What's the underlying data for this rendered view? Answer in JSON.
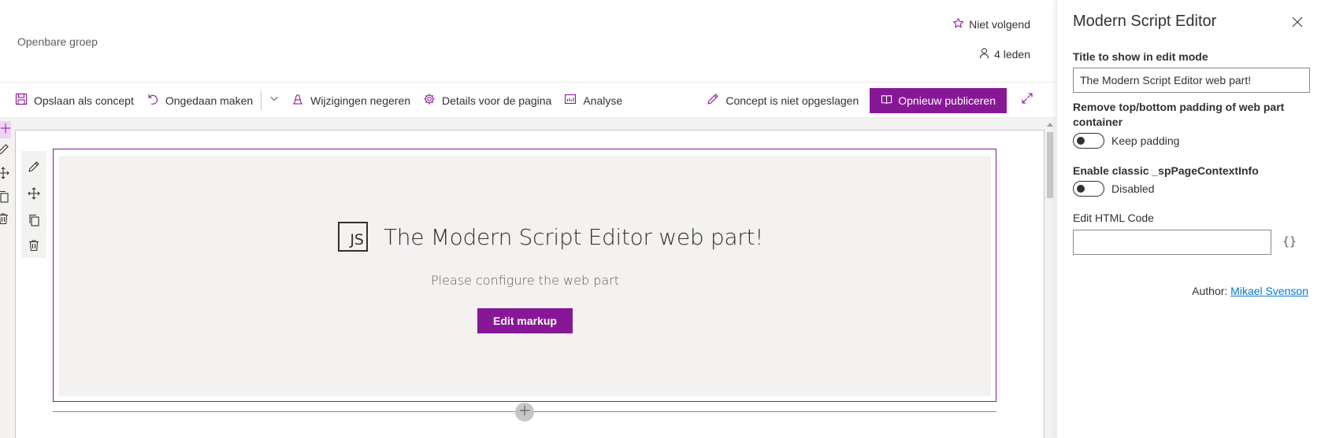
{
  "header": {
    "group_type": "Openbare groep",
    "follow_label": "Niet volgend",
    "members_label": "4 leden"
  },
  "toolbar": {
    "save_draft": "Opslaan als concept",
    "undo": "Ongedaan maken",
    "discard": "Wijzigingen negeren",
    "page_details": "Details voor de pagina",
    "analytics": "Analyse",
    "draft_status": "Concept is niet opgeslagen",
    "republish": "Opnieuw publiceren"
  },
  "webpart": {
    "logo_text": "JS",
    "title": "The Modern Script Editor web part!",
    "subtitle": "Please configure the web part",
    "edit_button": "Edit markup"
  },
  "pane": {
    "title": "Modern Script Editor",
    "title_field_label": "Title to show in edit mode",
    "title_field_value": "The Modern Script Editor web part!",
    "padding_label": "Remove top/bottom padding of web part container",
    "padding_toggle_text": "Keep padding",
    "padding_toggle_on": false,
    "context_label": "Enable classic _spPageContextInfo",
    "context_toggle_text": "Disabled",
    "context_toggle_on": false,
    "html_label": "Edit HTML Code",
    "html_value": "",
    "braces": "{}",
    "author_prefix": "Author:",
    "author_name": "Mikael Svenson"
  },
  "colors": {
    "accent": "#881798",
    "link": "#0078d4",
    "canvas_bg": "#f3f2f1"
  }
}
